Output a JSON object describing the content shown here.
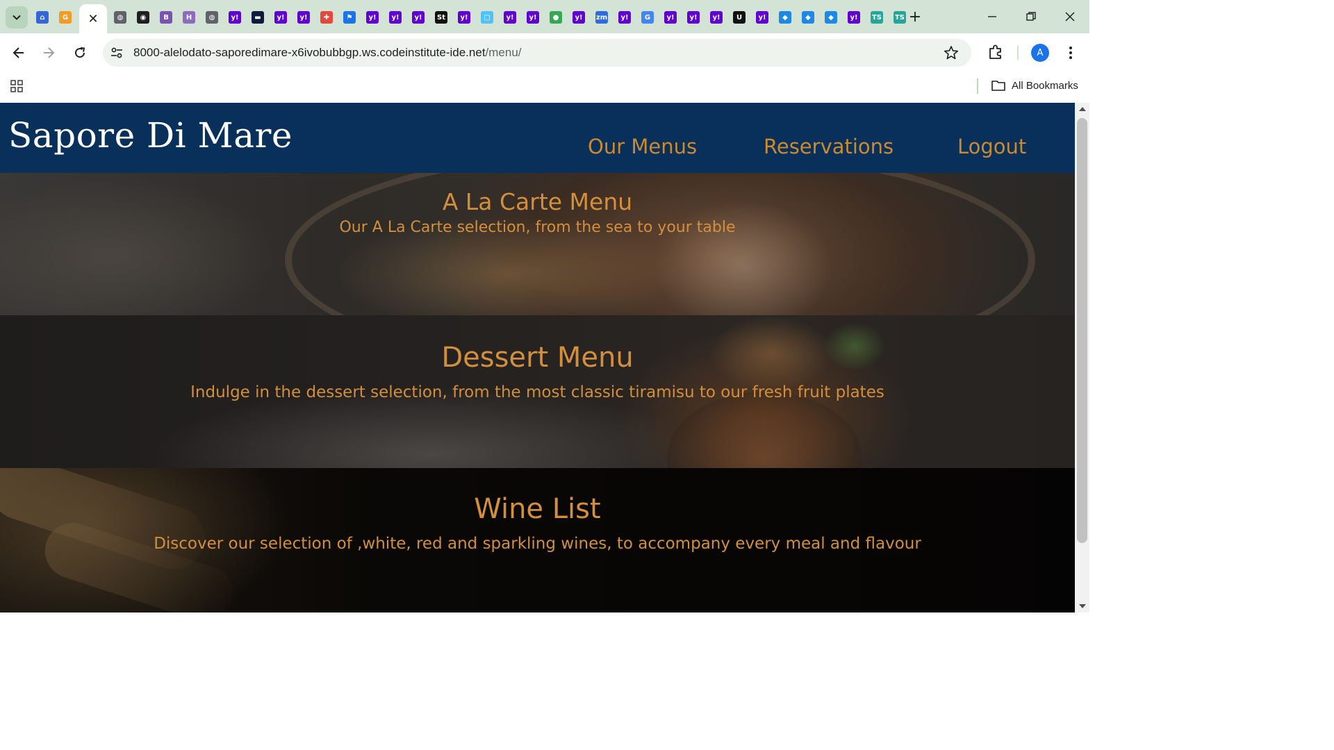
{
  "browser": {
    "address_url": "8000-alelodato-saporedimare-x6ivobubbgp.ws.codeinstitute-ide.net",
    "address_path": "/menu/",
    "profile_initial": "A",
    "bookmarks_label": "All Bookmarks",
    "tab_favicons": [
      {
        "name": "tab-favicon-home",
        "glyph": "⌂",
        "color": "#3367d6"
      },
      {
        "name": "tab-favicon-g-orange",
        "glyph": "G",
        "color": "#f59a23"
      },
      {
        "name": "tab-favicon-globe",
        "glyph": "◍",
        "color": "#5f6368"
      },
      {
        "name": "tab-favicon-github",
        "glyph": "◉",
        "color": "#1f1f1f"
      },
      {
        "name": "tab-favicon-bootstrap",
        "glyph": "B",
        "color": "#7952b3"
      },
      {
        "name": "tab-favicon-h",
        "glyph": "H",
        "color": "#8e6bbf"
      },
      {
        "name": "tab-favicon-globe",
        "glyph": "◍",
        "color": "#5f6368"
      },
      {
        "name": "tab-favicon-yahoo",
        "glyph": "y!",
        "color": "#6001d2"
      },
      {
        "name": "tab-favicon-dark",
        "glyph": "▬",
        "color": "#0b1a3d"
      },
      {
        "name": "tab-favicon-yahoo",
        "glyph": "y!",
        "color": "#6001d2"
      },
      {
        "name": "tab-favicon-yahoo",
        "glyph": "y!",
        "color": "#6001d2"
      },
      {
        "name": "tab-favicon-multicolor",
        "glyph": "✚",
        "color": "#e8453c"
      },
      {
        "name": "tab-favicon-flag",
        "glyph": "⚑",
        "color": "#1a73e8"
      },
      {
        "name": "tab-favicon-yahoo",
        "glyph": "y!",
        "color": "#6001d2"
      },
      {
        "name": "tab-favicon-yahoo",
        "glyph": "y!",
        "color": "#6001d2"
      },
      {
        "name": "tab-favicon-yahoo",
        "glyph": "y!",
        "color": "#6001d2"
      },
      {
        "name": "tab-favicon-st",
        "glyph": "St",
        "color": "#111111"
      },
      {
        "name": "tab-favicon-yahoo",
        "glyph": "y!",
        "color": "#6001d2"
      },
      {
        "name": "tab-favicon-frame",
        "glyph": "▢",
        "color": "#4fc3f7"
      },
      {
        "name": "tab-favicon-yahoo",
        "glyph": "y!",
        "color": "#6001d2"
      },
      {
        "name": "tab-favicon-yahoo",
        "glyph": "y!",
        "color": "#6001d2"
      },
      {
        "name": "tab-favicon-maps",
        "glyph": "●",
        "color": "#34a853"
      },
      {
        "name": "tab-favicon-yahoo",
        "glyph": "y!",
        "color": "#6001d2"
      },
      {
        "name": "tab-favicon-zoom",
        "glyph": "zm",
        "color": "#2d6cdf"
      },
      {
        "name": "tab-favicon-yahoo",
        "glyph": "y!",
        "color": "#6001d2"
      },
      {
        "name": "tab-favicon-google",
        "glyph": "G",
        "color": "#4285f4"
      },
      {
        "name": "tab-favicon-yahoo",
        "glyph": "y!",
        "color": "#6001d2"
      },
      {
        "name": "tab-favicon-yahoo",
        "glyph": "y!",
        "color": "#6001d2"
      },
      {
        "name": "tab-favicon-yahoo",
        "glyph": "y!",
        "color": "#6001d2"
      },
      {
        "name": "tab-favicon-u",
        "glyph": "U",
        "color": "#111111"
      },
      {
        "name": "tab-favicon-yahoo",
        "glyph": "y!",
        "color": "#6001d2"
      },
      {
        "name": "tab-favicon-diamond",
        "glyph": "◆",
        "color": "#1e88e5"
      },
      {
        "name": "tab-favicon-diamond",
        "glyph": "◆",
        "color": "#1e88e5"
      },
      {
        "name": "tab-favicon-diamond",
        "glyph": "◆",
        "color": "#1e88e5"
      },
      {
        "name": "tab-favicon-yahoo",
        "glyph": "y!",
        "color": "#6001d2"
      },
      {
        "name": "tab-favicon-ts",
        "glyph": "TS",
        "color": "#26a69a"
      },
      {
        "name": "tab-favicon-ts",
        "glyph": "TS",
        "color": "#26a69a"
      }
    ]
  },
  "site": {
    "brand": "Sapore Di Mare",
    "nav": {
      "menus": "Our Menus",
      "reservations": "Reservations",
      "logout": "Logout"
    },
    "sections": {
      "alacarte": {
        "title": "A La Carte Menu",
        "description": "Our A La Carte selection, from the sea to your table"
      },
      "dessert": {
        "title": "Dessert Menu",
        "description": "Indulge in the dessert selection, from the most classic tiramisu to our fresh fruit plates"
      },
      "wine": {
        "title": "Wine List",
        "description": "Discover our selection of ,white, red and sparkling wines, to accompany every meal and flavour"
      }
    }
  },
  "colors": {
    "navbar": "#08305a",
    "accent": "#d38f3b",
    "tabstrip": "#d3e3d6"
  }
}
